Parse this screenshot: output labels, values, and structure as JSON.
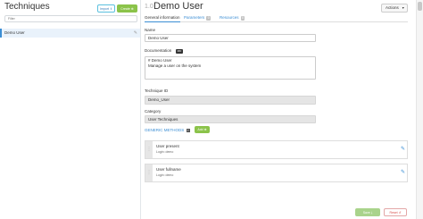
{
  "sidebar": {
    "title": "Techniques",
    "import_label": "Import",
    "create_label": "Create",
    "filter_placeholder": "Filter",
    "items": [
      {
        "label": "Demo User"
      }
    ]
  },
  "header": {
    "version": "1.0",
    "title": "Demo User",
    "actions_label": "Actions"
  },
  "tabs": [
    {
      "label": "General information"
    },
    {
      "label": "Parameters",
      "count": "0"
    },
    {
      "label": "Resources",
      "count": "0"
    }
  ],
  "form": {
    "name_label": "Name",
    "name_value": "Demo User",
    "doc_label": "Documentation",
    "doc_badge": "MD",
    "doc_line1": "# Demo User",
    "doc_line2": "Manage a user on the system",
    "id_label": "Technique ID",
    "id_value": "Demo_User",
    "category_label": "Category",
    "category_value": "User Techniques"
  },
  "methods": {
    "heading": "GENERIC METHODS",
    "help": "?",
    "add_label": "Add",
    "items": [
      {
        "name": "User present",
        "param": "Login: demo"
      },
      {
        "name": "User fullname",
        "param": "Login: demo"
      }
    ]
  },
  "footer": {
    "save_label": "Save",
    "reset_label": "Reset"
  }
}
